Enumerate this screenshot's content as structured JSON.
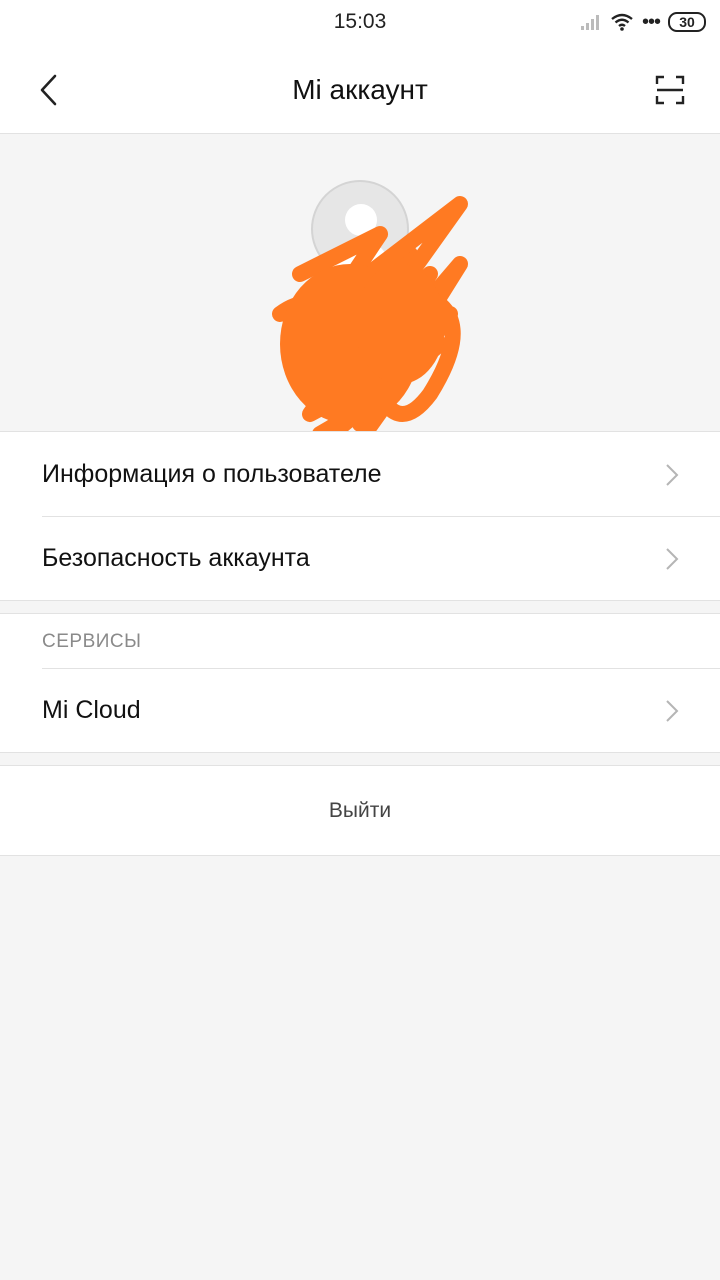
{
  "status_bar": {
    "time": "15:03",
    "battery": "30",
    "icons": [
      "signal-icon",
      "wifi-icon",
      "more-dots-icon",
      "battery-icon"
    ]
  },
  "header": {
    "title": "Mi аккаунт",
    "back_icon": "back-arrow-icon",
    "scan_icon": "scan-icon"
  },
  "profile": {
    "avatar_icon": "default-avatar-icon"
  },
  "account_items": [
    {
      "label": "Информация о пользователе"
    },
    {
      "label": "Безопасность аккаунта"
    }
  ],
  "services": {
    "header": "СЕРВИСЫ",
    "items": [
      {
        "label": "Mi Cloud"
      }
    ]
  },
  "logout": {
    "label": "Выйти"
  },
  "colors": {
    "background": "#f5f5f5",
    "card": "#ffffff",
    "divider": "#e2e2e2",
    "scribble": "#ff7a22",
    "muted_text": "#8a8a8a"
  }
}
